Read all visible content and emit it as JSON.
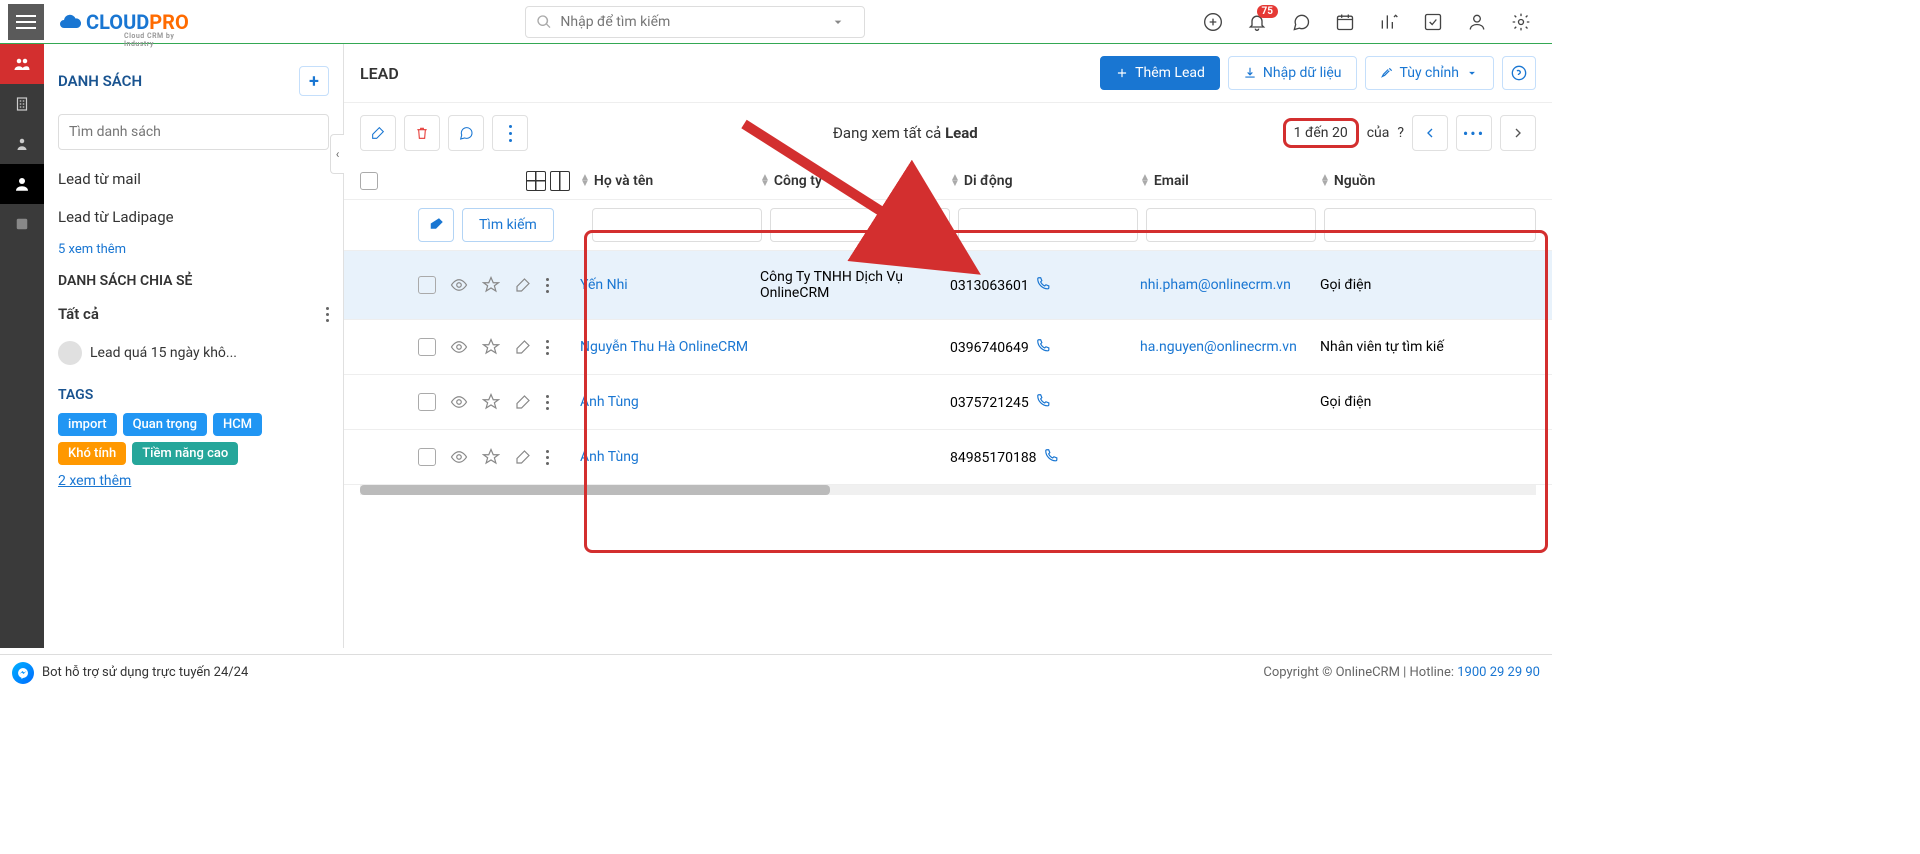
{
  "topbar": {
    "search_placeholder": "Nhập để tìm kiếm",
    "notification_count": "75"
  },
  "page": {
    "title": "LEAD",
    "add_button": "Thêm Lead",
    "import_button": "Nhập dữ liệu",
    "customize_button": "Tùy chỉnh"
  },
  "sidebar": {
    "list_title": "DANH SÁCH",
    "search_placeholder": "Tìm danh sách",
    "items": [
      "Lead từ mail",
      "Lead từ Ladipage"
    ],
    "more_link": "5 xem thêm",
    "shared_title": "DANH SÁCH CHIA SẺ",
    "all_label": "Tất cả",
    "shared_item": "Lead quá 15 ngày khô...",
    "tags_title": "TAGS",
    "tags": [
      {
        "label": "import",
        "color": "#2196f3"
      },
      {
        "label": "Quan trọng",
        "color": "#2196f3"
      },
      {
        "label": "HCM",
        "color": "#2196f3"
      },
      {
        "label": "Khó tính",
        "color": "#ff9800"
      },
      {
        "label": "Tiềm năng cao",
        "color": "#26a69a"
      }
    ],
    "tags_more": "2  xem thêm"
  },
  "toolbar": {
    "viewing_prefix": "Đang xem tất cả ",
    "viewing_entity": "Lead",
    "page_range": "1 đến 20",
    "page_of": "của",
    "page_total": "?"
  },
  "table": {
    "headers": {
      "name": "Họ và tên",
      "company": "Công ty",
      "mobile": "Di động",
      "email": "Email",
      "source": "Nguồn"
    },
    "search_label": "Tìm kiếm",
    "rows": [
      {
        "name": "Yến Nhi",
        "company": "Công Ty TNHH Dịch Vụ OnlineCRM",
        "mobile": "0313063601",
        "email": "nhi.pham@onlinecrm.vn",
        "source": "Gọi điện",
        "hl": true
      },
      {
        "name": "Nguyễn Thu Hà OnlineCRM",
        "company": "",
        "mobile": "0396740649",
        "email": "ha.nguyen@onlinecrm.vn",
        "source": "Nhân viên tự tìm kiế",
        "hl": false
      },
      {
        "name": "Anh Tùng",
        "company": "",
        "mobile": "0375721245",
        "email": "",
        "source": "Gọi điện",
        "hl": false
      },
      {
        "name": "Anh Tùng",
        "company": "",
        "mobile": "84985170188",
        "email": "",
        "source": "",
        "hl": false
      }
    ]
  },
  "footer": {
    "support": "Bot hỗ trợ sử dụng trực tuyến 24/24",
    "copyright_prefix": "Copyright © OnlineCRM | Hotline: ",
    "hotline": "1900 29 29 90"
  }
}
